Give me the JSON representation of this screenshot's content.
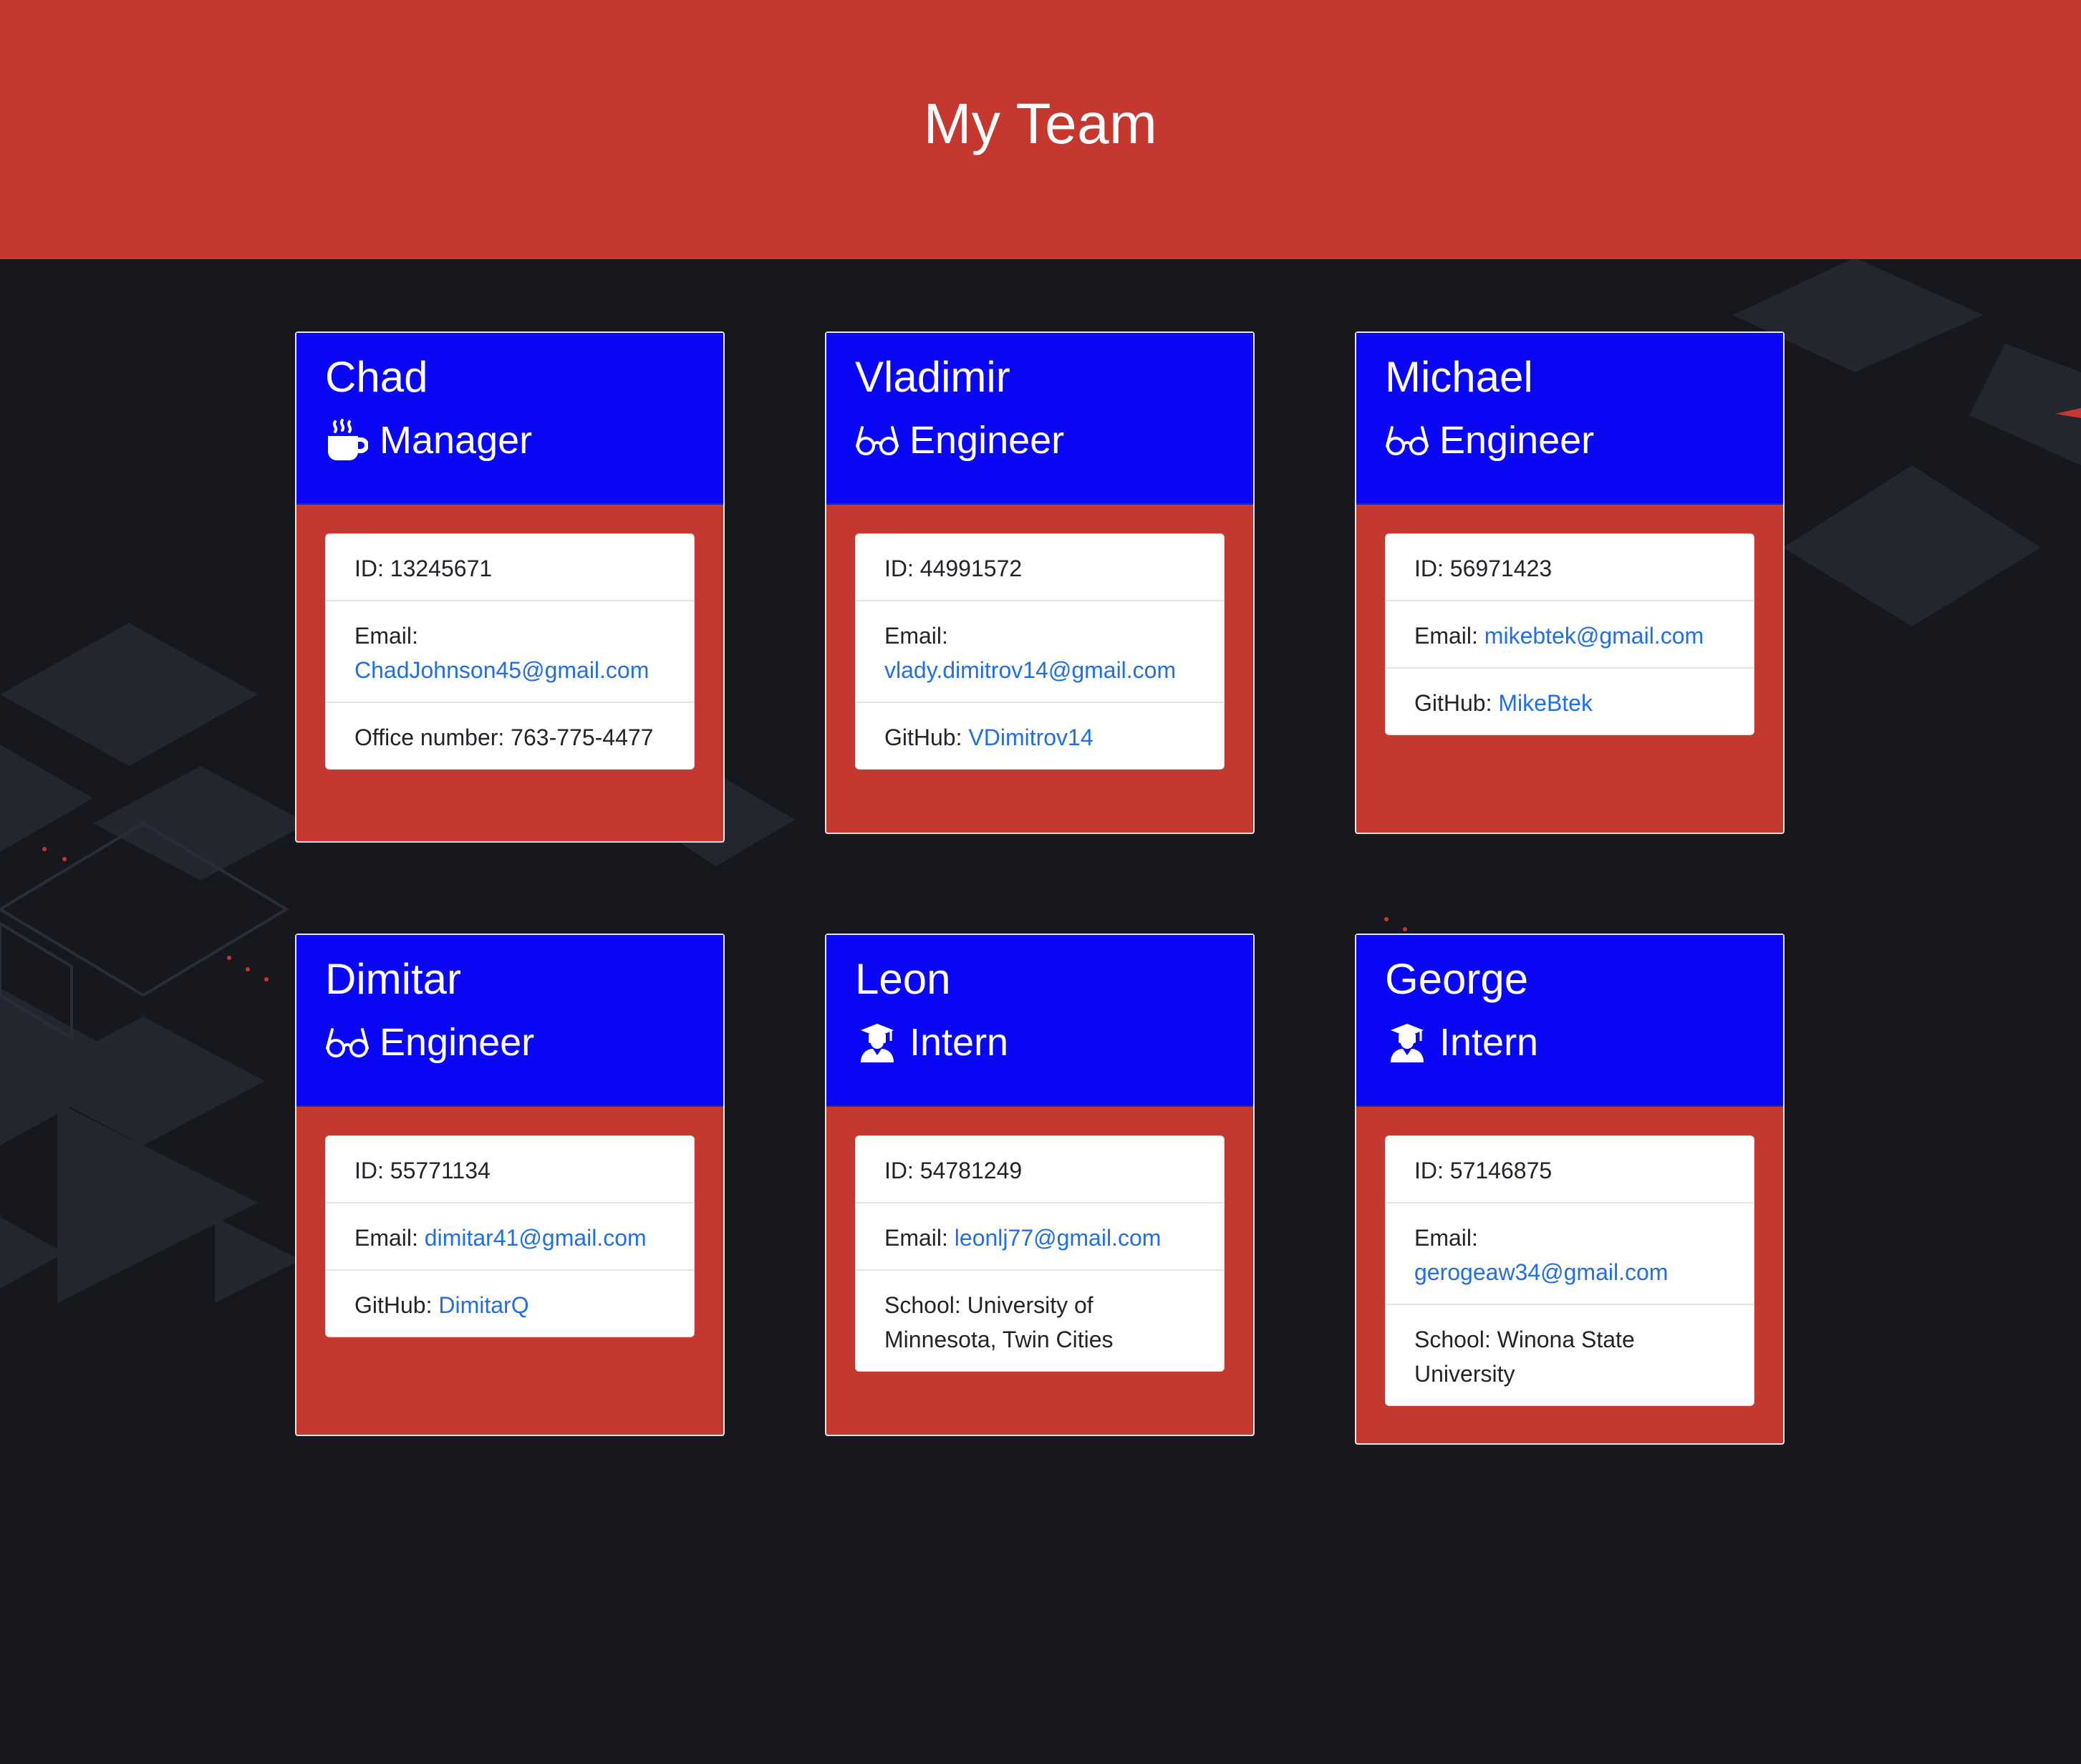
{
  "page": {
    "title": "My Team"
  },
  "colors": {
    "header_red": "#c53830",
    "card_blue": "#0a07f4",
    "link_blue": "#1f6fe6",
    "background": "#17181e"
  },
  "cards": [
    {
      "name": "Chad",
      "role": "Manager",
      "icon": "coffee-mug-icon",
      "id": "ID: 13245671",
      "email_label": "Email: ",
      "email": "ChadJohnson45@gmail.com",
      "extra_label": "Office number: 763-775-4477",
      "extra_value": ""
    },
    {
      "name": "Vladimir",
      "role": "Engineer",
      "icon": "glasses-icon",
      "id": "ID: 44991572",
      "email_label": "Email: ",
      "email": "vlady.dimitrov14@gmail.com",
      "extra_label": "GitHub: ",
      "extra_value": "VDimitrov14"
    },
    {
      "name": "Michael",
      "role": "Engineer",
      "icon": "glasses-icon",
      "id": "ID: 56971423",
      "email_label": "Email: ",
      "email": "mikebtek@gmail.com",
      "extra_label": "GitHub: ",
      "extra_value": "MikeBtek"
    },
    {
      "name": "Dimitar",
      "role": "Engineer",
      "icon": "glasses-icon",
      "id": "ID: 55771134",
      "email_label": "Email: ",
      "email": "dimitar41@gmail.com",
      "extra_label": "GitHub: ",
      "extra_value": "DimitarQ"
    },
    {
      "name": "Leon",
      "role": "Intern",
      "icon": "graduate-icon",
      "id": "ID: 54781249",
      "email_label": "Email: ",
      "email": "leonlj77@gmail.com",
      "extra_label": "School: University of Minnesota, Twin Cities",
      "extra_value": ""
    },
    {
      "name": "George",
      "role": "Intern",
      "icon": "graduate-icon",
      "id": "ID: 57146875",
      "email_label": "Email: ",
      "email": "gerogeaw34@gmail.com",
      "extra_label": "School: Winona State University",
      "extra_value": ""
    }
  ]
}
